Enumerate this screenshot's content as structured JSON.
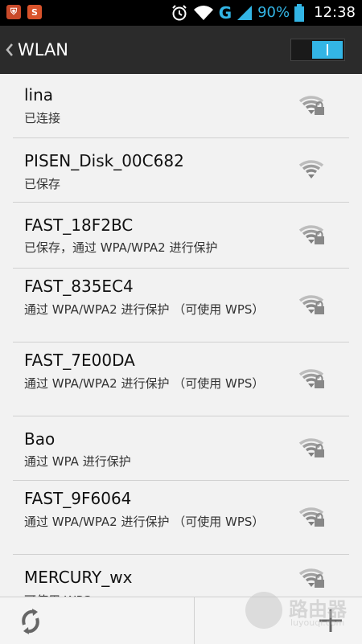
{
  "statusbar": {
    "app_icons": [
      {
        "name": "shield-app-icon",
        "color": "#c94a2a",
        "glyph": "⛨"
      },
      {
        "name": "s-app-icon",
        "color": "#d9532b",
        "glyph": "S"
      }
    ],
    "network_type": "G",
    "battery_percent": "90%",
    "time": "12:38"
  },
  "actionbar": {
    "title": "WLAN",
    "toggle_on": true
  },
  "networks": [
    {
      "ssid": "lina",
      "status": "已连接",
      "locked": true
    },
    {
      "ssid": "PISEN_Disk_00C682",
      "status": "已保存",
      "locked": false
    },
    {
      "ssid": "FAST_18F2BC",
      "status": "已保存，通过 WPA/WPA2 进行保护",
      "locked": true
    },
    {
      "ssid": "FAST_835EC4",
      "status": "通过 WPA/WPA2 进行保护 （可使用 WPS）",
      "locked": true
    },
    {
      "ssid": "FAST_7E00DA",
      "status": "通过 WPA/WPA2 进行保护 （可使用 WPS）",
      "locked": true
    },
    {
      "ssid": "Bao",
      "status": "通过 WPA 进行保护",
      "locked": true
    },
    {
      "ssid": "FAST_9F6064",
      "status": "通过 WPA/WPA2 进行保护 （可使用 WPS）",
      "locked": true
    },
    {
      "ssid": "MERCURY_wx",
      "status": "可使用 WPS",
      "locked": true
    }
  ],
  "watermark": {
    "text": "路由器",
    "sub": "luyouqi.com"
  },
  "colors": {
    "accent": "#33b5e5",
    "actionbar": "#2b2b2b"
  }
}
